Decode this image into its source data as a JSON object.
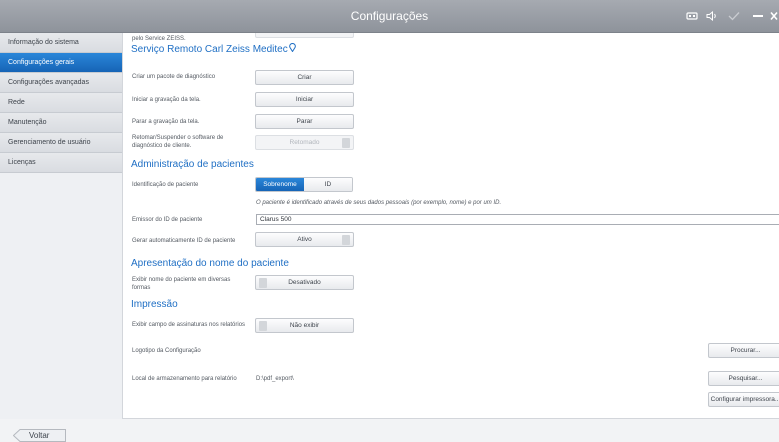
{
  "window": {
    "title": "Configurações"
  },
  "titlebar_icons": [
    "usb-icon",
    "speaker-icon",
    "checkmark-icon",
    "minimize-icon",
    "close-icon"
  ],
  "sidebar": {
    "items": [
      {
        "label": "Informação do sistema",
        "active": false
      },
      {
        "label": "Configurações gerais",
        "active": true
      },
      {
        "label": "Configurações avançadas",
        "active": false
      },
      {
        "label": "Rede",
        "active": false
      },
      {
        "label": "Manutenção",
        "active": false
      },
      {
        "label": "Gerenciamento de usuário",
        "active": false
      },
      {
        "label": "Licenças",
        "active": false
      }
    ]
  },
  "main": {
    "top_partial_text": "pelo Service ZEISS.",
    "remote_service": {
      "title": "Serviço Remoto Carl Zeiss Meditec",
      "title_icon": "location-pin-icon",
      "rows": [
        {
          "label": "Criar um pacote de diagnóstico",
          "button": "Criar"
        },
        {
          "label": "Iniciar a gravação da tela.",
          "button": "Iniciar"
        },
        {
          "label": "Parar a gravação da tela.",
          "button": "Parar"
        },
        {
          "label": "Retomar/Suspender o software de diagnóstico de cliente.",
          "button": "Retomado"
        }
      ]
    },
    "patient_admin": {
      "title": "Administração de pacientes",
      "identification_label": "Identificação de paciente",
      "identification_options": [
        "Sobrenome",
        "ID"
      ],
      "identification_selected": "Sobrenome",
      "identification_hint": "O paciente é identificado através de seus dados pessoais (por exemplo, nome) e por um ID.",
      "issuer_label": "Emissor do ID de paciente",
      "issuer_value": "Clarus 500",
      "autogen_label": "Gerar automaticamente ID de paciente",
      "autogen_value": "Ativo"
    },
    "name_display": {
      "title": "Apresentação do nome do paciente",
      "label": "Exibir nome do paciente em diversas formas",
      "value": "Desativado"
    },
    "printing": {
      "title": "Impressão",
      "signature_label": "Exibir campo de assinaturas nos relatórios",
      "signature_value": "Não exibir",
      "logo_label": "Logotipo da Configuração",
      "logo_button": "Procurar...",
      "storage_label": "Local de armazenamento para relatório",
      "storage_path": "D:\\pdf_export\\",
      "storage_button": "Pesquisar...",
      "printer_button": "Configurar impressora..."
    }
  },
  "footer": {
    "back_label": "Voltar"
  },
  "colors": {
    "accent": "#1f6fc4",
    "active_nav": "#1e74c8",
    "titlebar": "#9a9ea5"
  }
}
